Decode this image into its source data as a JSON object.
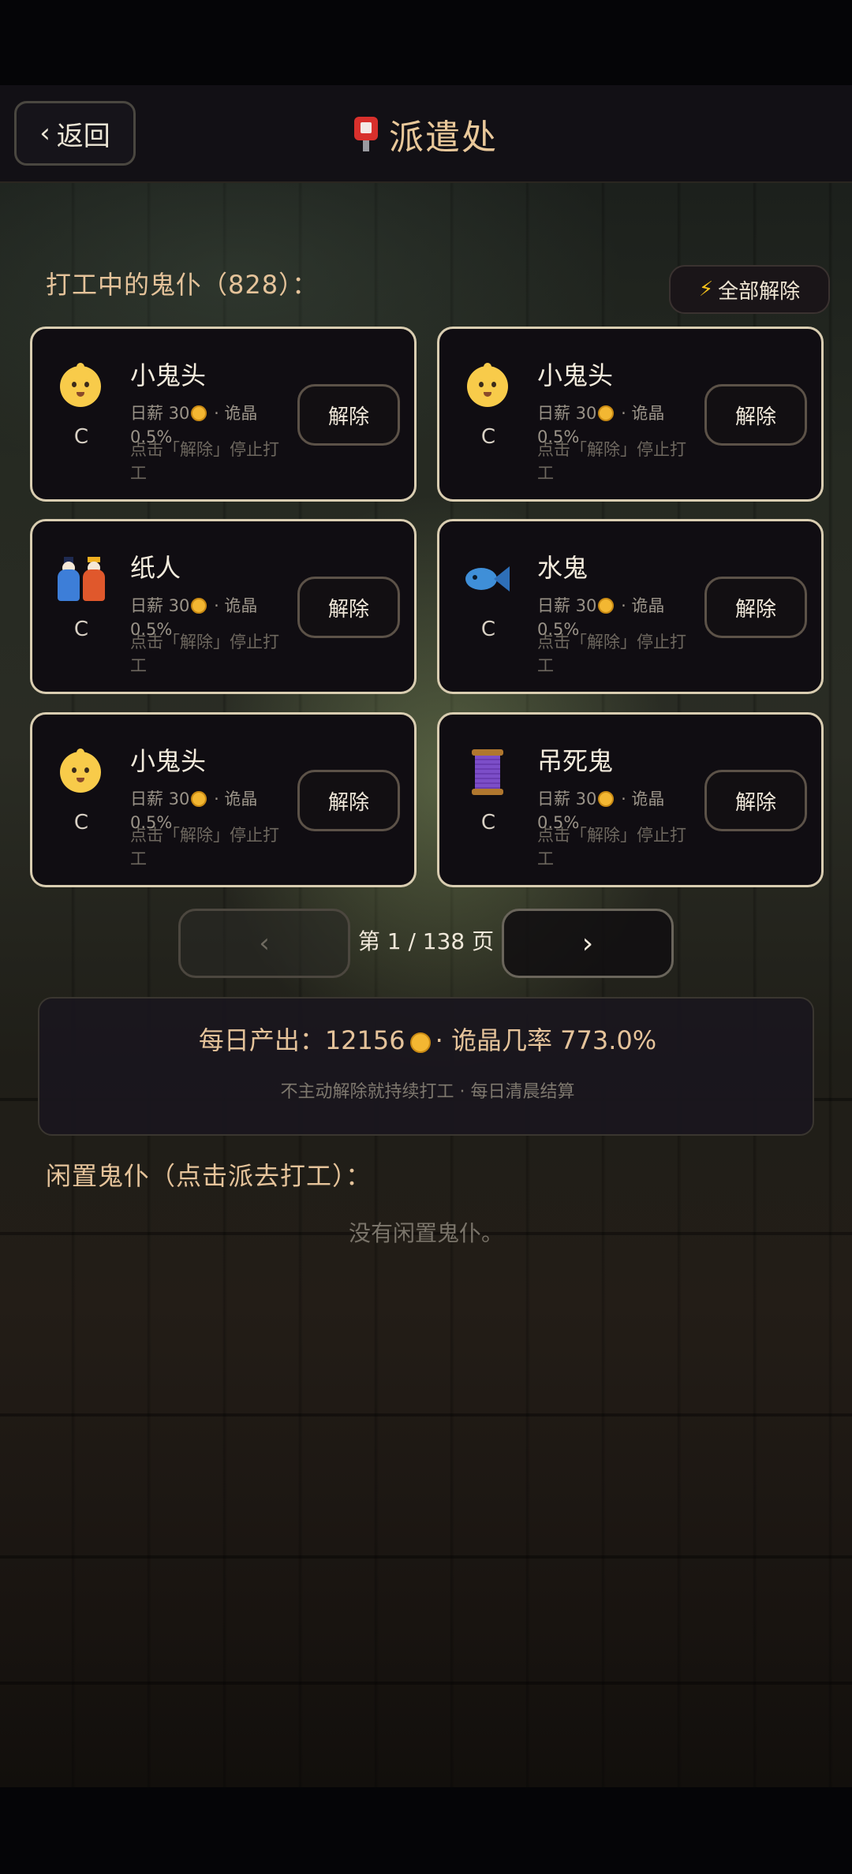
{
  "header": {
    "back_label": "返回",
    "title": "派遣处"
  },
  "working": {
    "section_label": "打工中的鬼仆（828）：",
    "release_all_label": "全部解除",
    "cards": [
      {
        "icon": "baby-face-icon",
        "name": "小鬼头",
        "grade": "C",
        "wage_prefix": "日薪 30",
        "wage_suffix": " · 诡晶",
        "rate": "0.5%",
        "hint": "点击「解除」停止打工",
        "button": "解除"
      },
      {
        "icon": "baby-face-icon",
        "name": "小鬼头",
        "grade": "C",
        "wage_prefix": "日薪 30",
        "wage_suffix": " · 诡晶",
        "rate": "0.5%",
        "hint": "点击「解除」停止打工",
        "button": "解除"
      },
      {
        "icon": "paper-dolls-icon",
        "name": "纸人",
        "grade": "C",
        "wage_prefix": "日薪 30",
        "wage_suffix": " · 诡晶",
        "rate": "0.5%",
        "hint": "点击「解除」停止打工",
        "button": "解除"
      },
      {
        "icon": "fish-icon",
        "name": "水鬼",
        "grade": "C",
        "wage_prefix": "日薪 30",
        "wage_suffix": " · 诡晶",
        "rate": "0.5%",
        "hint": "点击「解除」停止打工",
        "button": "解除"
      },
      {
        "icon": "baby-face-icon",
        "name": "小鬼头",
        "grade": "C",
        "wage_prefix": "日薪 30",
        "wage_suffix": " · 诡晶",
        "rate": "0.5%",
        "hint": "点击「解除」停止打工",
        "button": "解除"
      },
      {
        "icon": "thread-spool-icon",
        "name": "吊死鬼",
        "grade": "C",
        "wage_prefix": "日薪 30",
        "wage_suffix": " · 诡晶",
        "rate": "0.5%",
        "hint": "点击「解除」停止打工",
        "button": "解除"
      }
    ]
  },
  "pager": {
    "prev_label": "‹",
    "next_label": "›",
    "page_text": "第 1 / 138 页"
  },
  "summary": {
    "main_prefix": "每日产出：12156",
    "main_suffix": "· 诡晶几率 773.0%",
    "sub": "不主动解除就持续打工 · 每日清晨结算"
  },
  "idle": {
    "section_label": "闲置鬼仆（点击派去打工）：",
    "empty_text": "没有闲置鬼仆。"
  },
  "colors": {
    "accent": "#e5c39a",
    "card_border": "#d9cdb1",
    "coin": "#f3b732"
  }
}
